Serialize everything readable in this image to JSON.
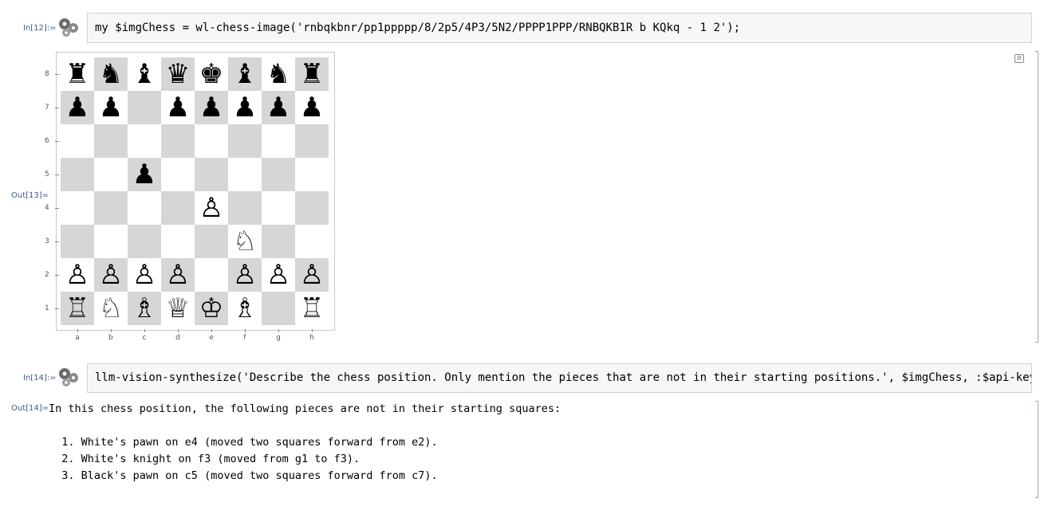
{
  "cells": [
    {
      "in_label": "In[12]:=",
      "code": "my $imgChess = wl-chess-image('rnbqkbnr/pp1ppppp/8/2p5/4P3/5N2/PPPP1PPP/RNBQKB1R b KQkq - 1 2');",
      "out_label": "Out[13]="
    },
    {
      "in_label": "In[14]:=",
      "code": "llm-vision-synthesize('Describe the chess position. Only mention the pieces that are not in their starting positions.', $imgChess, :$api-key)",
      "out_label": "Out[14]="
    }
  ],
  "board": {
    "ranks": [
      "8",
      "7",
      "6",
      "5",
      "4",
      "3",
      "2",
      "1"
    ],
    "files": [
      "a",
      "b",
      "c",
      "d",
      "e",
      "f",
      "g",
      "h"
    ],
    "rows": [
      [
        "♜",
        "♞",
        "♝",
        "♛",
        "♚",
        "♝",
        "♞",
        "♜"
      ],
      [
        "♟",
        "♟",
        "",
        "♟",
        "♟",
        "♟",
        "♟",
        "♟"
      ],
      [
        "",
        "",
        "",
        "",
        "",
        "",
        "",
        ""
      ],
      [
        "",
        "",
        "♟",
        "",
        "",
        "",
        "",
        ""
      ],
      [
        "",
        "",
        "",
        "",
        "♙",
        "",
        "",
        ""
      ],
      [
        "",
        "",
        "",
        "",
        "",
        "♘",
        "",
        ""
      ],
      [
        "♙",
        "♙",
        "♙",
        "♙",
        "",
        "♙",
        "♙",
        "♙"
      ],
      [
        "♖",
        "♘",
        "♗",
        "♕",
        "♔",
        "♗",
        "",
        "♖"
      ]
    ],
    "dark_color": "#d6d6d6",
    "light_color": "#ffffff"
  },
  "output_text": "In this chess position, the following pieces are not in their starting squares:\n\n  1. White's pawn on e4 (moved two squares forward from e2).\n  2. White's knight on f3 (moved from g1 to f3).\n  3. Black's pawn on c5 (moved two squares forward from c7).",
  "colors": {
    "label": "#3a5d8a",
    "input_bg": "#f7f7f7"
  }
}
